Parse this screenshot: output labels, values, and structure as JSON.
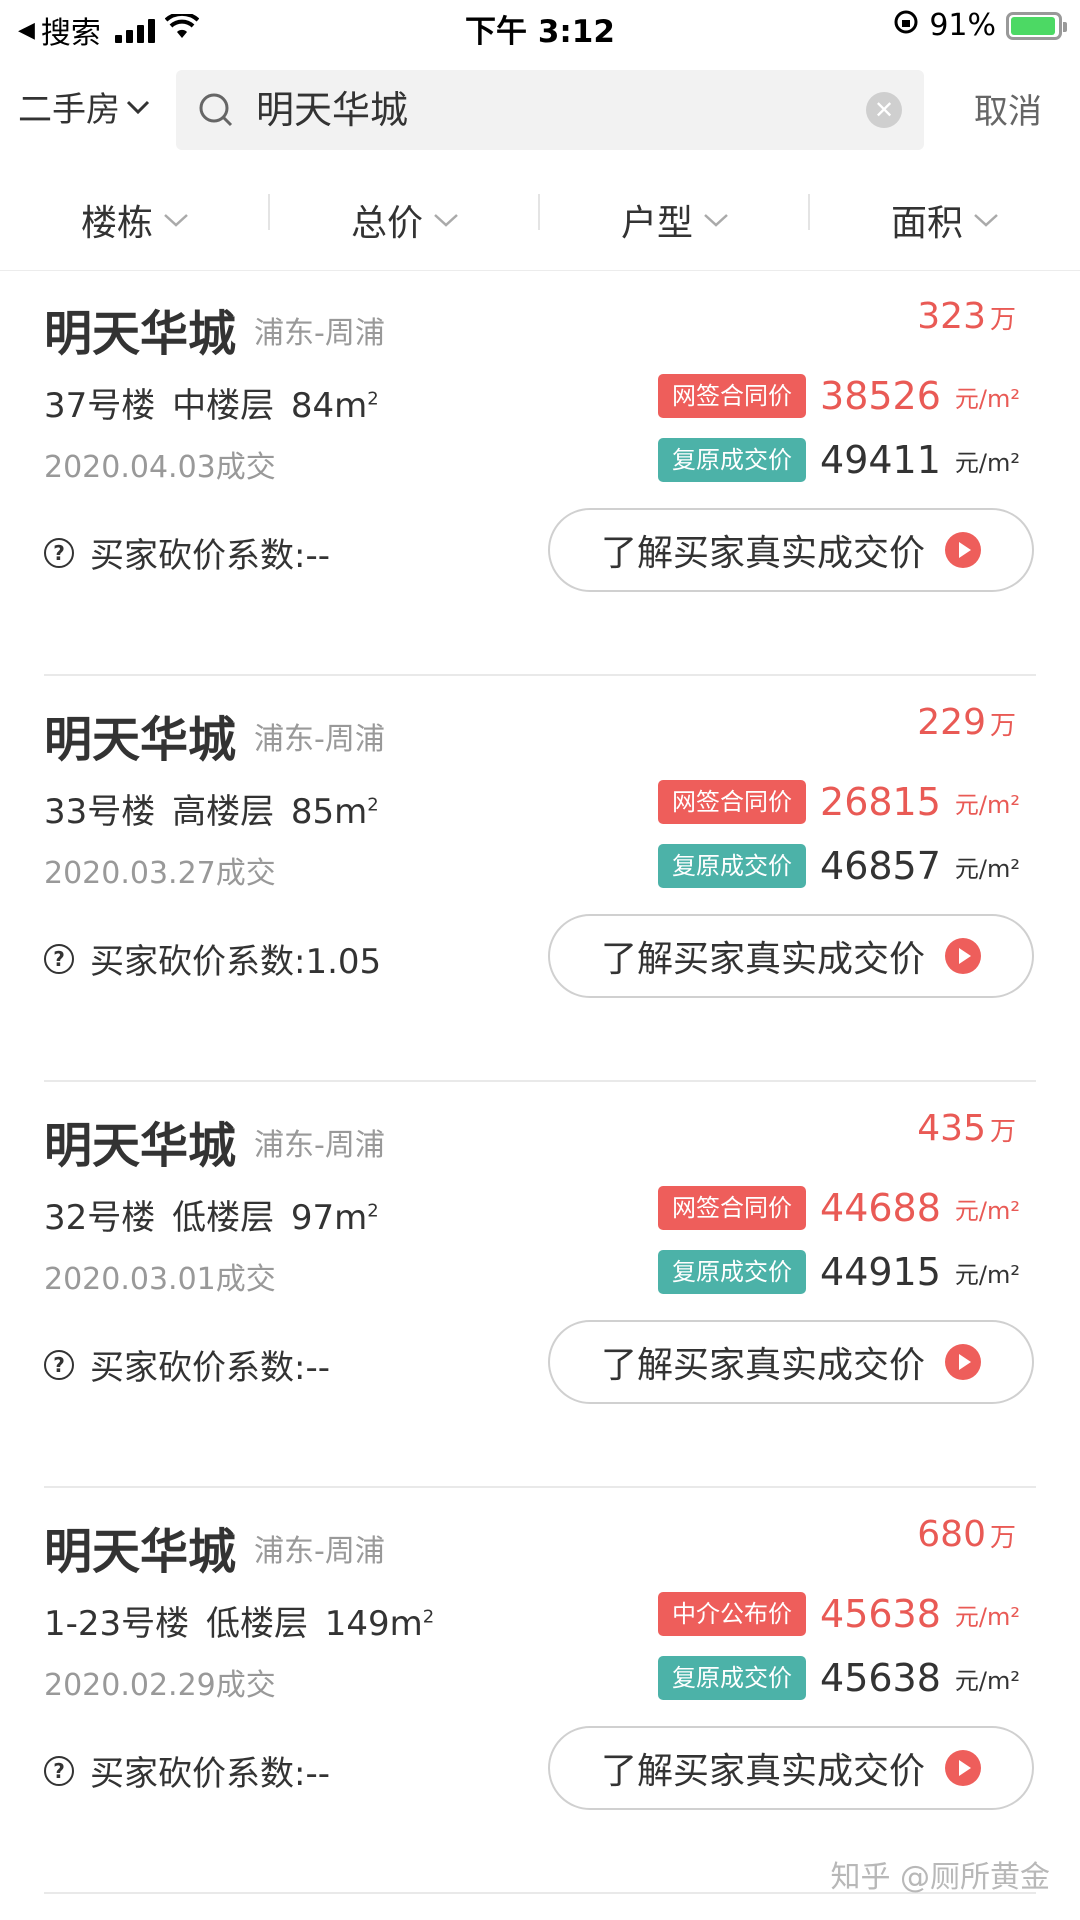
{
  "status_bar": {
    "back_label": "搜索",
    "time": "下午 3:12",
    "battery": "91%"
  },
  "search": {
    "city_filter": "二手房",
    "query": "明天华城",
    "cancel": "取消"
  },
  "filters": [
    "楼栋",
    "总价",
    "户型",
    "面积"
  ],
  "listings": [
    {
      "name": "明天华城",
      "district": "浦东-周浦",
      "total_price": "323",
      "total_unit": "万",
      "info": "37号楼 中楼层 84m",
      "date": "2020.04.03成交",
      "tag1": "网签合同价",
      "price1": "38526",
      "tag2": "复原成交价",
      "price2": "49411",
      "unit": "元/m²",
      "coef_label": "买家砍价系数:--",
      "button": "了解买家真实成交价"
    },
    {
      "name": "明天华城",
      "district": "浦东-周浦",
      "total_price": "229",
      "total_unit": "万",
      "info": "33号楼 高楼层 85m",
      "date": "2020.03.27成交",
      "tag1": "网签合同价",
      "price1": "26815",
      "tag2": "复原成交价",
      "price2": "46857",
      "unit": "元/m²",
      "coef_label": "买家砍价系数:1.05",
      "button": "了解买家真实成交价"
    },
    {
      "name": "明天华城",
      "district": "浦东-周浦",
      "total_price": "435",
      "total_unit": "万",
      "info": "32号楼 低楼层 97m",
      "date": "2020.03.01成交",
      "tag1": "网签合同价",
      "price1": "44688",
      "tag2": "复原成交价",
      "price2": "44915",
      "unit": "元/m²",
      "coef_label": "买家砍价系数:--",
      "button": "了解买家真实成交价"
    },
    {
      "name": "明天华城",
      "district": "浦东-周浦",
      "total_price": "680",
      "total_unit": "万",
      "info": "1-23号楼 低楼层 149m",
      "date": "2020.02.29成交",
      "tag1": "中介公布价",
      "price1": "45638",
      "tag2": "复原成交价",
      "price2": "45638",
      "unit": "元/m²",
      "coef_label": "买家砍价系数:--",
      "button": "了解买家真实成交价"
    }
  ],
  "watermark": "知乎 @厕所黄金"
}
